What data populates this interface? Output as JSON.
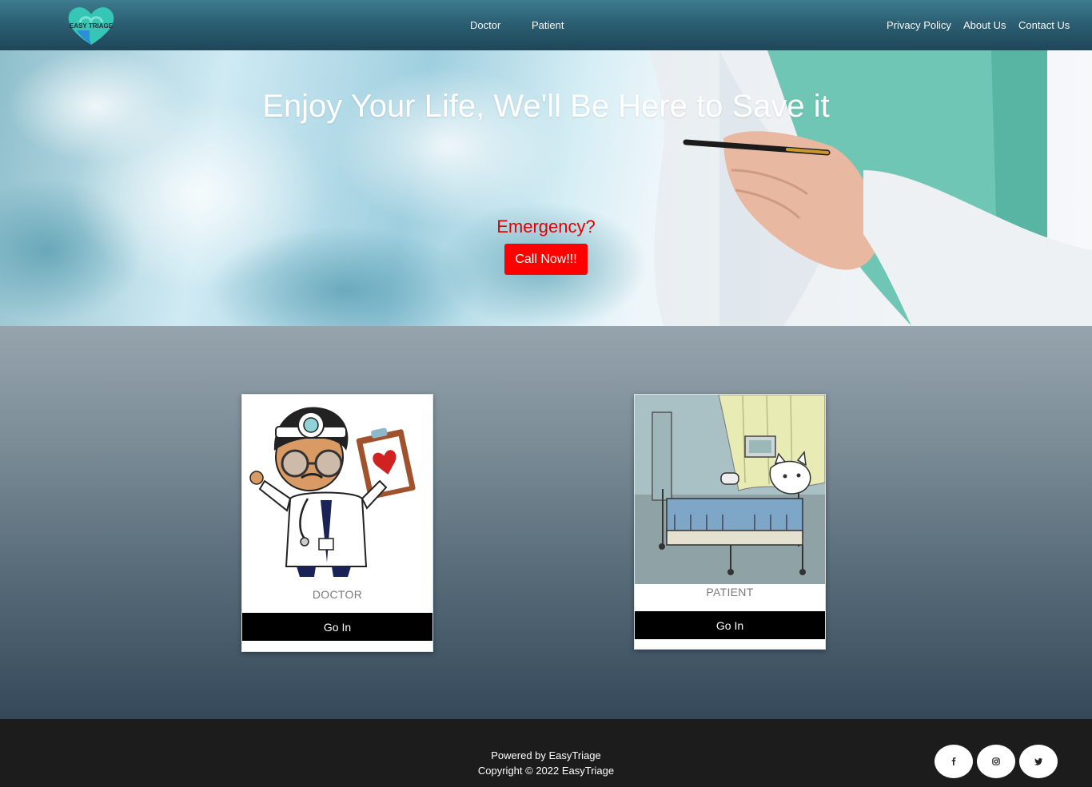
{
  "nav": {
    "logo_text": "EASY TRIAGE",
    "center_links": [
      "Doctor",
      "Patient"
    ],
    "right_links": [
      "Privacy Policy",
      "About Us",
      "Contact Us"
    ]
  },
  "hero": {
    "title": "Enjoy Your Life, We'll Be Here to Save it",
    "emergency_text": "Emergency?",
    "call_button": "Call Now!!!"
  },
  "cards": {
    "doctor": {
      "label": "DOCTOR",
      "button": "Go In"
    },
    "patient": {
      "label": "PATIENT",
      "button": "Go In"
    }
  },
  "footer": {
    "powered_by": "Powered by EasyTriage",
    "copyright": "Copyright © 2022 EasyTriage",
    "social_icons": [
      "facebook-icon",
      "instagram-icon",
      "twitter-icon"
    ]
  },
  "colors": {
    "nav": "#2c5f73",
    "call_button": "#ff0000",
    "emergency_text": "#e00000",
    "go_button": "#000000",
    "footer": "#1c1c1c",
    "logo_heart": "#35c6b5"
  }
}
